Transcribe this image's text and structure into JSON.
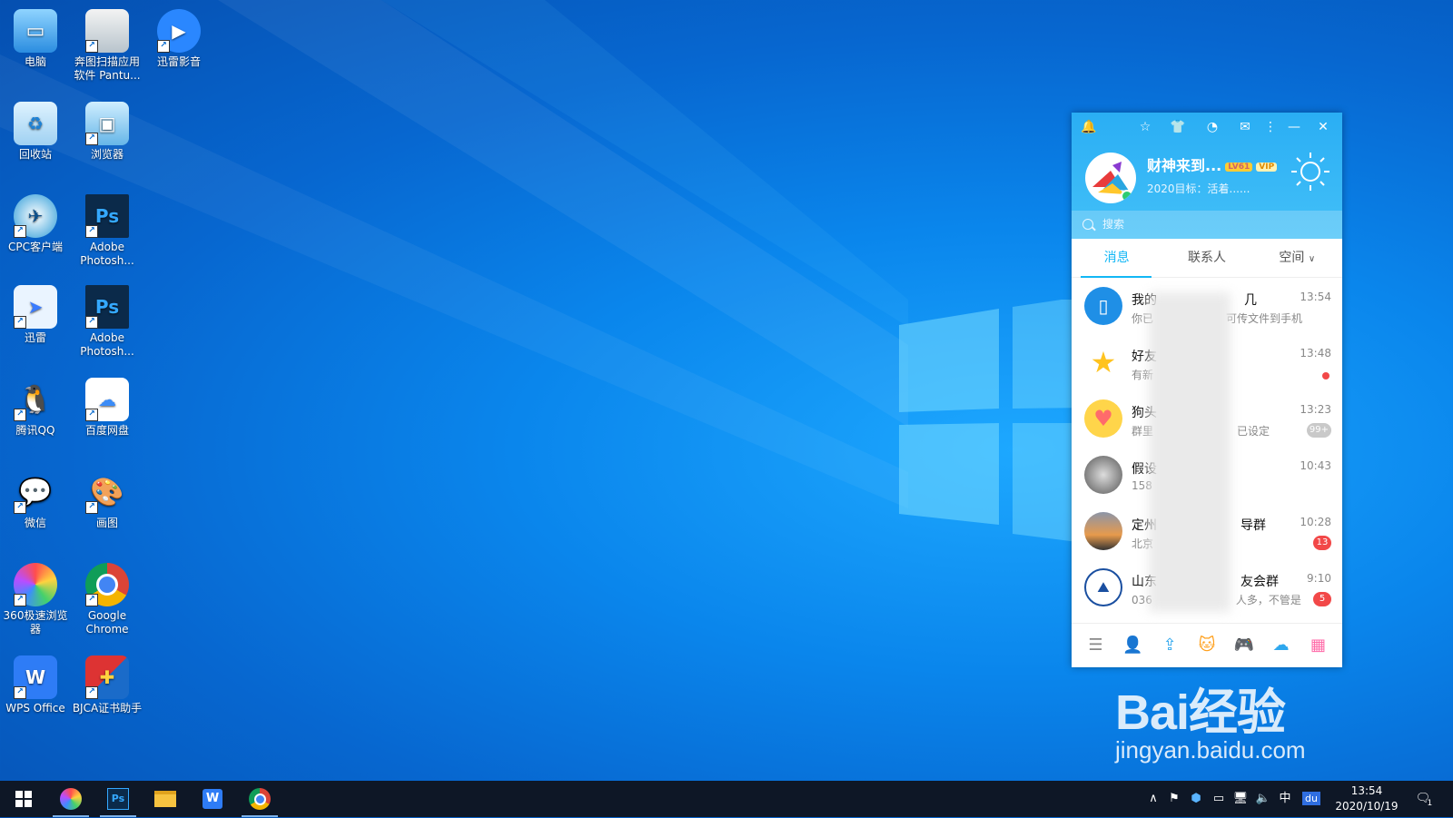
{
  "desktop": {
    "icons": [
      {
        "label": "电脑"
      },
      {
        "label": "奔图扫描应用软件 Pantu..."
      },
      {
        "label": "迅雷影音"
      },
      {
        "label": "回收站"
      },
      {
        "label": "浏览器"
      },
      {
        "label": "CPC客户端"
      },
      {
        "label": "Adobe Photosh..."
      },
      {
        "label": "迅雷"
      },
      {
        "label": "Adobe Photosh..."
      },
      {
        "label": "腾讯QQ"
      },
      {
        "label": "百度网盘"
      },
      {
        "label": "微信"
      },
      {
        "label": "画图"
      },
      {
        "label": "360极速浏览器"
      },
      {
        "label": "Google Chrome"
      },
      {
        "label": "WPS Office"
      },
      {
        "label": "BJCA证书助手"
      }
    ]
  },
  "qq": {
    "nickname": "财神来到...",
    "level_badge": "LV61",
    "vip_badge": "VIP",
    "signature": "2020目标：活着......",
    "search_placeholder": "搜索",
    "tabs": [
      "消息",
      "联系人",
      "空间"
    ],
    "messages": [
      {
        "name": "我的",
        "name_tail": "几",
        "preview": "你已",
        "preview_tail": "可传文件到手机",
        "time": "13:54",
        "badge": ""
      },
      {
        "name": "好友",
        "name_tail": "",
        "preview": "有新",
        "preview_tail": "",
        "time": "13:48",
        "badge": ""
      },
      {
        "name": "狗头",
        "name_tail": "",
        "preview": "群里",
        "preview_tail": "已设定",
        "time": "13:23",
        "badge": "99+"
      },
      {
        "name": "假设",
        "name_tail": "",
        "preview": "158",
        "preview_tail": "",
        "time": "10:43",
        "badge": ""
      },
      {
        "name": "定州",
        "name_tail": "导群",
        "preview": "北京",
        "preview_tail": "",
        "time": "10:28",
        "badge": "13"
      },
      {
        "name": "山东",
        "name_tail": "友会群",
        "preview": "036",
        "preview_tail": "人多，不管是",
        "time": "9:10",
        "badge": "5"
      }
    ]
  },
  "watermark": {
    "brand": "Bai经验",
    "url": "jingyan.baidu.com"
  },
  "taskbar": {
    "time": "13:54",
    "date": "2020/10/19",
    "ime": "中",
    "notification_count": "1"
  }
}
